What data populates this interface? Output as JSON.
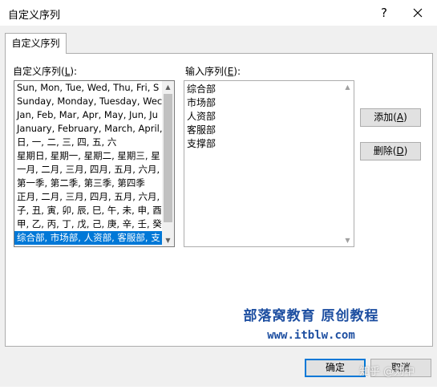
{
  "window": {
    "title": "自定义序列",
    "help": "?"
  },
  "tab": {
    "label": "自定义序列"
  },
  "left": {
    "label_pre": "自定义序列(",
    "label_key": "L",
    "label_post": "):",
    "items": [
      "Sun, Mon, Tue, Wed, Thu, Fri, S",
      "Sunday, Monday, Tuesday, Wec",
      "Jan, Feb, Mar, Apr, May, Jun, Ju",
      "January, February, March, April,",
      "日, 一, 二, 三, 四, 五, 六",
      "星期日, 星期一, 星期二, 星期三, 星",
      "一月, 二月, 三月, 四月, 五月, 六月,",
      "第一季, 第二季, 第三季, 第四季",
      "正月, 二月, 三月, 四月, 五月, 六月,",
      "子, 丑, 寅, 卯, 辰, 巳, 午, 未, 申, 酉",
      "甲, 乙, 丙, 丁, 戊, 己, 庚, 辛, 壬, 癸",
      "综合部, 市场部, 人资部, 客服部, 支"
    ],
    "selected_index": 11
  },
  "right": {
    "label_pre": "输入序列(",
    "label_key": "E",
    "label_post": "):",
    "lines": [
      "综合部",
      "市场部",
      "人资部",
      "客服部",
      "支撑部"
    ]
  },
  "buttons": {
    "add_pre": "添加(",
    "add_key": "A",
    "add_post": ")",
    "del_pre": "删除(",
    "del_key": "D",
    "del_post": ")",
    "ok": "确定",
    "cancel": "取消"
  },
  "watermark": {
    "line1": "部落窝教育 原创教程",
    "line2": "www.itblw.com"
  },
  "overlay": {
    "text": "知乎 @刘中"
  },
  "colors": {
    "selection": "#0078d7",
    "watermark": "#1e4fa1"
  }
}
